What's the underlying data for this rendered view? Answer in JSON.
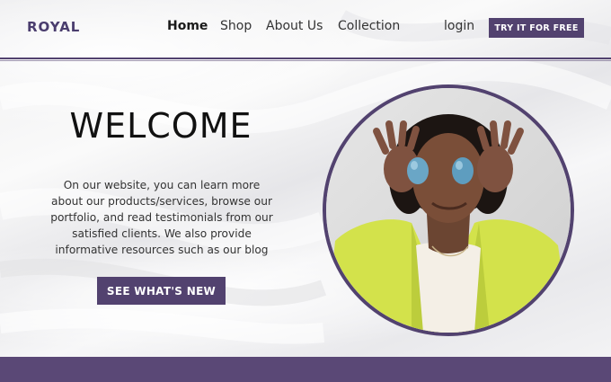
{
  "header": {
    "logo": "ROYAL",
    "nav": {
      "home": "Home",
      "shop": "Shop",
      "about": "About Us",
      "collection": "Collection",
      "login": "login"
    },
    "cta_label": "TRY IT FOR FREE"
  },
  "hero": {
    "title": "WELCOME",
    "body": "On our website, you can learn more about our products/services, browse our portfolio, and read testimonials from our satisfied clients. We also provide informative resources such as our blog",
    "cta_label": "SEE WHAT'S NEW",
    "photo_icon": "woman-with-eggs-photo"
  },
  "colors": {
    "brand": "#52426f",
    "footer": "#5a4876",
    "jacket": "#d4e34a"
  }
}
